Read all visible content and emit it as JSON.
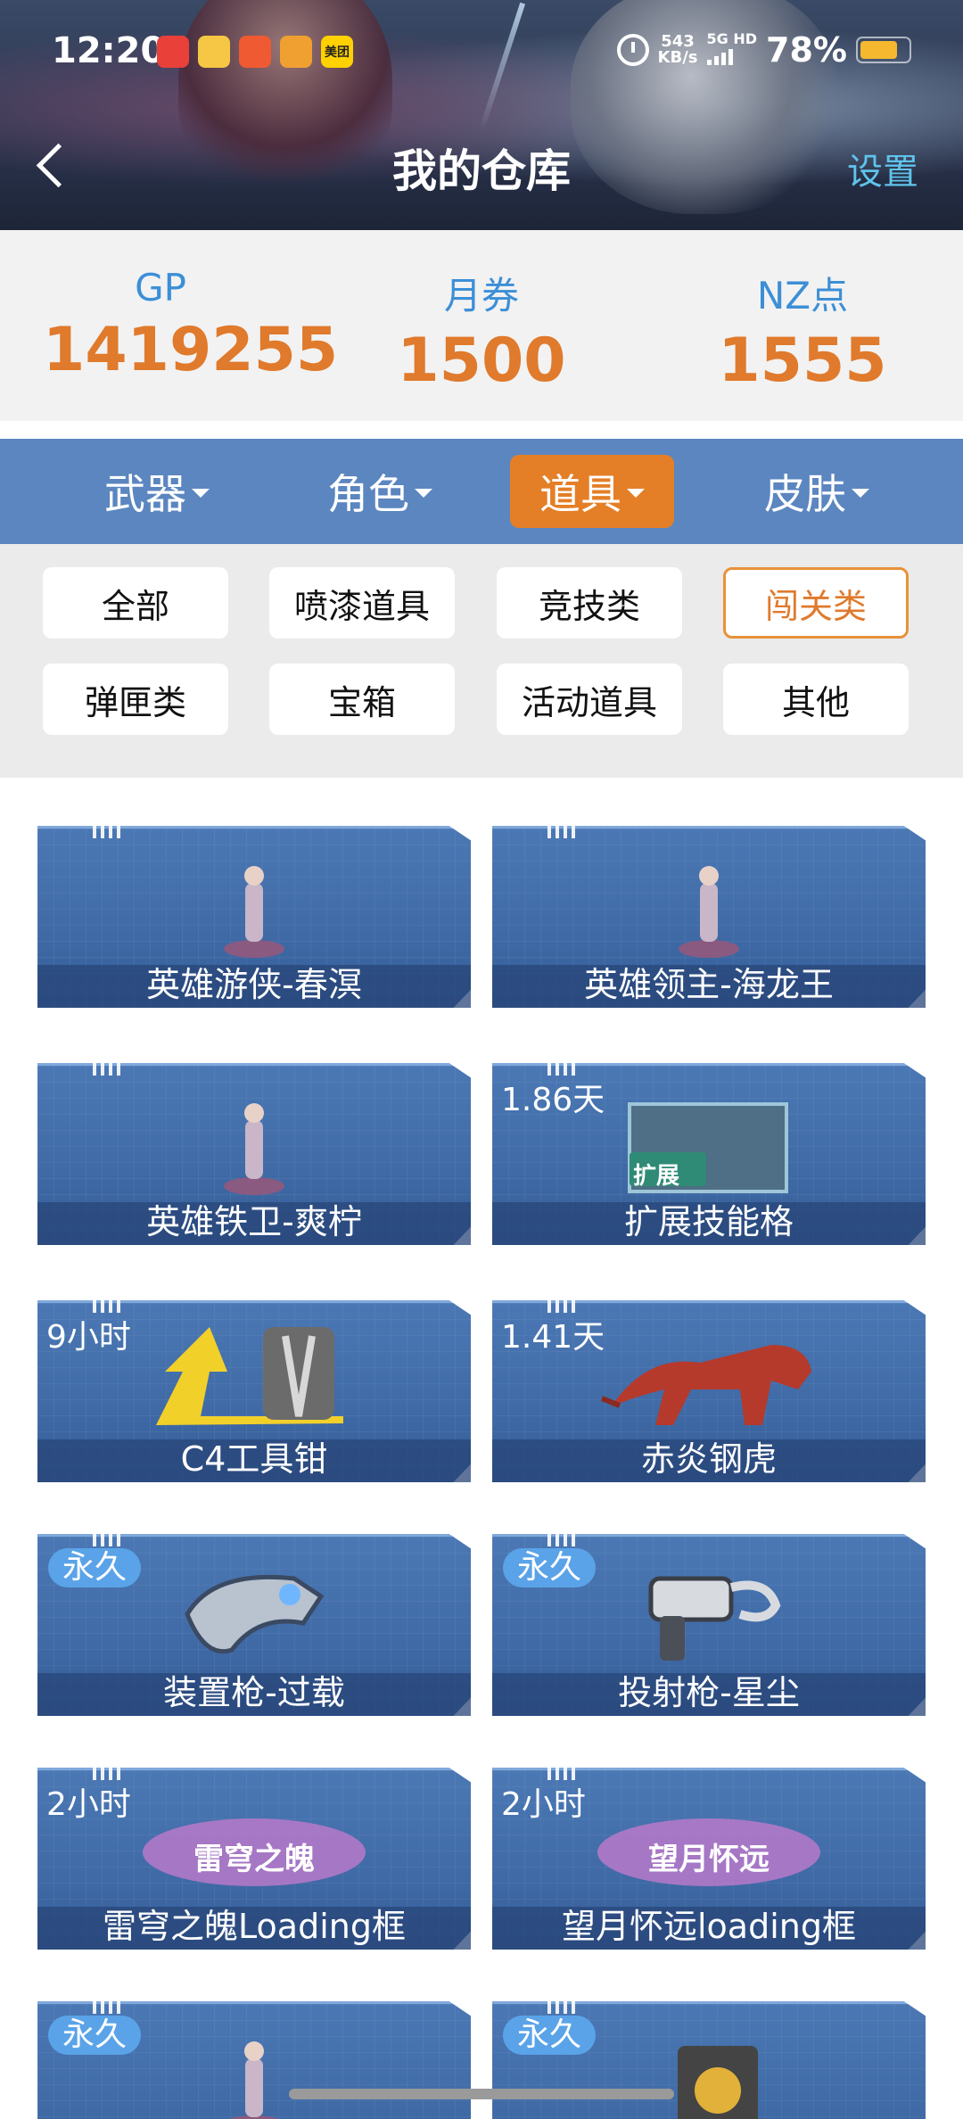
{
  "status_bar": {
    "time": "12:20",
    "apps": [
      {
        "icon": "notification-app-icon",
        "color": "#e9403a",
        "text": ""
      },
      {
        "icon": "notification-app-icon",
        "color": "#f6c744",
        "text": ""
      },
      {
        "icon": "notification-app-icon",
        "color": "#f05a32",
        "text": ""
      },
      {
        "icon": "notification-app-icon",
        "color": "#f0a030",
        "text": ""
      },
      {
        "icon": "meituan-icon",
        "color": "#ffd100",
        "text": "美团"
      }
    ],
    "net_speed_value": "543",
    "net_speed_unit": "KB/s",
    "signal": "5G HD",
    "battery": "78%",
    "battery_level": 0.78
  },
  "header": {
    "title": "我的仓库",
    "settings": "设置"
  },
  "currency": [
    {
      "label": "GP",
      "value": "1419255"
    },
    {
      "label": "月券",
      "value": "1500"
    },
    {
      "label": "NZ点",
      "value": "1555"
    }
  ],
  "tabs": [
    {
      "label": "武器",
      "active": false
    },
    {
      "label": "角色",
      "active": false
    },
    {
      "label": "道具",
      "active": true
    },
    {
      "label": "皮肤",
      "active": false
    }
  ],
  "filters": [
    {
      "label": "全部",
      "active": false
    },
    {
      "label": "喷漆道具",
      "active": false
    },
    {
      "label": "竞技类",
      "active": false
    },
    {
      "label": "闯关类",
      "active": true
    },
    {
      "label": "弹匣类",
      "active": false
    },
    {
      "label": "宝箱",
      "active": false
    },
    {
      "label": "活动道具",
      "active": false
    },
    {
      "label": "其他",
      "active": false
    }
  ],
  "items": [
    {
      "name": "英雄游侠-春溟",
      "badge": "",
      "badge_style": "none",
      "art": "hero-figure-icon"
    },
    {
      "name": "英雄领主-海龙王",
      "badge": "",
      "badge_style": "none",
      "art": "hero-figure-icon"
    },
    {
      "name": "英雄铁卫-爽柠",
      "badge": "",
      "badge_style": "none",
      "art": "hero-figure-icon"
    },
    {
      "name": "扩展技能格",
      "badge": "1.86天",
      "badge_style": "plain",
      "art": "skill-slot-icon",
      "art_text": "扩展"
    },
    {
      "name": "C4工具钳",
      "badge": "9小时",
      "badge_style": "plain",
      "art": "pliers-icon"
    },
    {
      "name": "赤炎钢虎",
      "badge": "1.41天",
      "badge_style": "plain",
      "art": "tiger-icon"
    },
    {
      "name": "装置枪-过载",
      "badge": "永久",
      "badge_style": "pill",
      "art": "device-gun-icon"
    },
    {
      "name": "投射枪-星尘",
      "badge": "永久",
      "badge_style": "pill",
      "art": "projector-gun-icon"
    },
    {
      "name": "雷穹之魄Loading框",
      "badge": "2小时",
      "badge_style": "plain",
      "art": "loading-frame-icon",
      "art_text": "雷穹之魄"
    },
    {
      "name": "望月怀远loading框",
      "badge": "2小时",
      "badge_style": "plain",
      "art": "loading-frame-icon",
      "art_text": "望月怀远"
    },
    {
      "name": "",
      "badge": "永久",
      "badge_style": "pill",
      "art": "hero-figure-icon"
    },
    {
      "name": "",
      "badge": "永久",
      "badge_style": "pill",
      "art": "chest-icon"
    }
  ]
}
